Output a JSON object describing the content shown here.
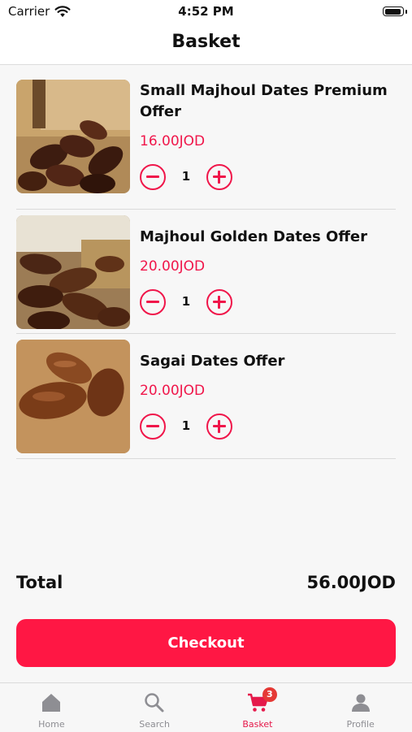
{
  "status_bar": {
    "carrier": "Carrier",
    "time": "4:52 PM"
  },
  "header": {
    "title": "Basket"
  },
  "basket": {
    "items": [
      {
        "name": "Small Majhoul Dates Premium Offer",
        "price": "16.00JOD",
        "quantity": "1"
      },
      {
        "name": "Majhoul Golden Dates Offer",
        "price": "20.00JOD",
        "quantity": "1"
      },
      {
        "name": "Sagai Dates Offer",
        "price": "20.00JOD",
        "quantity": "1"
      }
    ],
    "total_label": "Total",
    "total_value": "56.00JOD",
    "checkout_label": "Checkout"
  },
  "tabs": [
    {
      "label": "Home",
      "icon": "home-icon"
    },
    {
      "label": "Search",
      "icon": "search-icon"
    },
    {
      "label": "Basket",
      "icon": "cart-icon",
      "badge": "3",
      "active": true
    },
    {
      "label": "Profile",
      "icon": "profile-icon"
    }
  ],
  "colors": {
    "accent": "#f0164a",
    "checkout": "#ff1744",
    "badge": "#e53935"
  }
}
